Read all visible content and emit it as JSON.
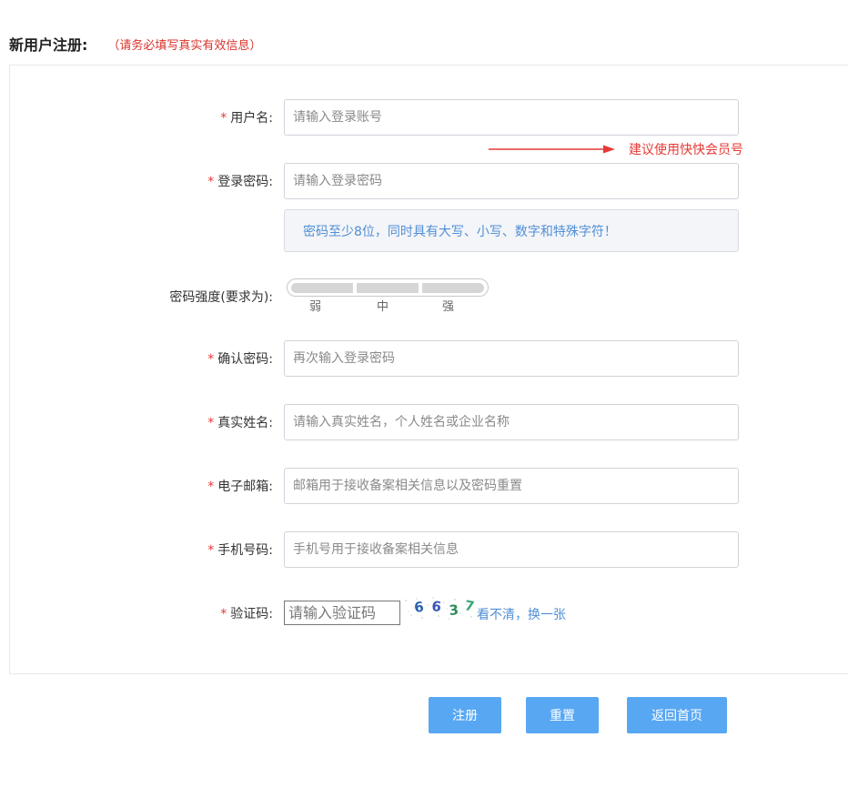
{
  "header": {
    "title": "新用户注册:",
    "note": "（请务必填写真实有效信息）"
  },
  "form": {
    "required_mark": "*",
    "username": {
      "label": "用户名:",
      "placeholder": "请输入登录账号",
      "tip": "建议使用快快会员号"
    },
    "password": {
      "label": "登录密码:",
      "placeholder": "请输入登录密码",
      "hint": "密码至少8位，同时具有大写、小写、数字和特殊字符！"
    },
    "strength": {
      "label": "密码强度(要求为):",
      "levels": [
        "弱",
        "中",
        "强"
      ]
    },
    "confirm_password": {
      "label": "确认密码:",
      "placeholder": "再次输入登录密码"
    },
    "real_name": {
      "label": "真实姓名:",
      "placeholder": "请输入真实姓名，个人姓名或企业名称"
    },
    "email": {
      "label": "电子邮箱:",
      "placeholder": "邮箱用于接收备案相关信息以及密码重置"
    },
    "phone": {
      "label": "手机号码:",
      "placeholder": "手机号用于接收备案相关信息"
    },
    "captcha": {
      "label": "验证码:",
      "placeholder": "请输入验证码",
      "code": [
        "6",
        "6",
        "3",
        "7"
      ],
      "refresh_link": "看不清，换一张"
    }
  },
  "buttons": {
    "register": "注册",
    "reset": "重置",
    "home": "返回首页"
  },
  "colors": {
    "required": "#e53935",
    "accent": "#58a7f2",
    "link": "#4f8fd6",
    "captcha_digits": [
      "#2a62b0",
      "#3a55b5",
      "#2e8a5a",
      "#3aa67a"
    ]
  }
}
